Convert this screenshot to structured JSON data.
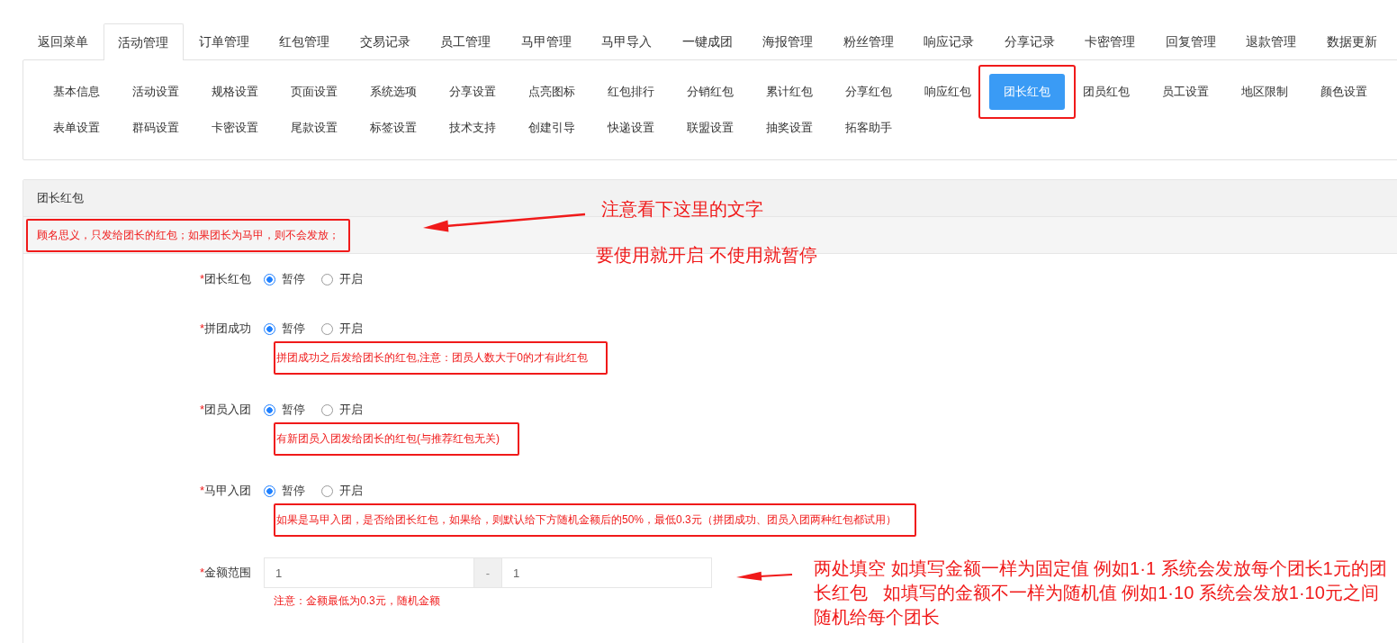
{
  "top_tabs": [
    {
      "label": "返回菜单",
      "selected": false
    },
    {
      "label": "活动管理",
      "selected": true
    },
    {
      "label": "订单管理",
      "selected": false
    },
    {
      "label": "红包管理",
      "selected": false
    },
    {
      "label": "交易记录",
      "selected": false
    },
    {
      "label": "员工管理",
      "selected": false
    },
    {
      "label": "马甲管理",
      "selected": false
    },
    {
      "label": "马甲导入",
      "selected": false
    },
    {
      "label": "一键成团",
      "selected": false
    },
    {
      "label": "海报管理",
      "selected": false
    },
    {
      "label": "粉丝管理",
      "selected": false
    },
    {
      "label": "响应记录",
      "selected": false
    },
    {
      "label": "分享记录",
      "selected": false
    },
    {
      "label": "卡密管理",
      "selected": false
    },
    {
      "label": "回复管理",
      "selected": false
    },
    {
      "label": "退款管理",
      "selected": false
    },
    {
      "label": "数据更新",
      "selected": false
    }
  ],
  "sub_tabs": [
    {
      "label": "基本信息",
      "selected": false,
      "annotated": false
    },
    {
      "label": "活动设置",
      "selected": false,
      "annotated": false
    },
    {
      "label": "规格设置",
      "selected": false,
      "annotated": false
    },
    {
      "label": "页面设置",
      "selected": false,
      "annotated": false
    },
    {
      "label": "系统选项",
      "selected": false,
      "annotated": false
    },
    {
      "label": "分享设置",
      "selected": false,
      "annotated": false
    },
    {
      "label": "点亮图标",
      "selected": false,
      "annotated": false
    },
    {
      "label": "红包排行",
      "selected": false,
      "annotated": false
    },
    {
      "label": "分销红包",
      "selected": false,
      "annotated": false
    },
    {
      "label": "累计红包",
      "selected": false,
      "annotated": false
    },
    {
      "label": "分享红包",
      "selected": false,
      "annotated": false
    },
    {
      "label": "响应红包",
      "selected": false,
      "annotated": false
    },
    {
      "label": "团长红包",
      "selected": true,
      "annotated": true
    },
    {
      "label": "团员红包",
      "selected": false,
      "annotated": false
    },
    {
      "label": "员工设置",
      "selected": false,
      "annotated": false
    },
    {
      "label": "地区限制",
      "selected": false,
      "annotated": false
    },
    {
      "label": "颜色设置",
      "selected": false,
      "annotated": false
    },
    {
      "label": "表单设置",
      "selected": false,
      "annotated": false
    },
    {
      "label": "群码设置",
      "selected": false,
      "annotated": false
    },
    {
      "label": "卡密设置",
      "selected": false,
      "annotated": false
    },
    {
      "label": "尾款设置",
      "selected": false,
      "annotated": false
    },
    {
      "label": "标签设置",
      "selected": false,
      "annotated": false
    },
    {
      "label": "技术支持",
      "selected": false,
      "annotated": false
    },
    {
      "label": "创建引导",
      "selected": false,
      "annotated": false
    },
    {
      "label": "快递设置",
      "selected": false,
      "annotated": false
    },
    {
      "label": "联盟设置",
      "selected": false,
      "annotated": false
    },
    {
      "label": "抽奖设置",
      "selected": false,
      "annotated": false
    },
    {
      "label": "拓客助手",
      "selected": false,
      "annotated": false
    }
  ],
  "panel": {
    "title": "团长红包",
    "notice": "顾名思义，只发给团长的红包；如果团长为马甲，则不会发放；",
    "notice_annotated": true
  },
  "form": [
    {
      "kind": "radio",
      "required_mark": "*",
      "label": "团长红包",
      "options": [
        {
          "label": "暂停",
          "selected": true
        },
        {
          "label": "开启",
          "selected": false
        }
      ]
    },
    {
      "kind": "radio",
      "required_mark": "*",
      "label": "拼团成功",
      "options": [
        {
          "label": "暂停",
          "selected": true
        },
        {
          "label": "开启",
          "selected": false
        }
      ],
      "hint": "拼团成功之后发给团长的红包,注意：团员人数大于0的才有此红包",
      "hint_annotated": true
    },
    {
      "kind": "radio",
      "required_mark": "*",
      "label": "团员入团",
      "options": [
        {
          "label": "暂停",
          "selected": true
        },
        {
          "label": "开启",
          "selected": false
        }
      ],
      "hint": "有新团员入团发给团长的红包(与推荐红包无关)",
      "hint_annotated": true
    },
    {
      "kind": "radio",
      "required_mark": "*",
      "label": "马甲入团",
      "options": [
        {
          "label": "暂停",
          "selected": true
        },
        {
          "label": "开启",
          "selected": false
        }
      ],
      "hint": "如果是马甲入团，是否给团长红包，如果给，则默认给下方随机金额后的50%，最低0.3元（拼团成功、团员入团两种红包都试用）",
      "hint_annotated": true
    },
    {
      "kind": "range",
      "required_mark": "*",
      "label": "金额范围",
      "min_value": "1",
      "separator": "-",
      "max_value": "1",
      "hint": "注意：金额最低为0.3元，随机金额",
      "hint_annotated": false
    }
  ],
  "annotation_notes": [
    {
      "text": "注意看下这里的文字"
    },
    {
      "text": "要使用就开启 不使用就暂停"
    },
    {
      "text": "两处填空 如填写金额一样为固定值 例如1·1 系统会发放每个团长1元的团长红包   如填写的金额不一样为随机值 例如1·10 系统会发放1·10元之间随机给每个团长"
    }
  ]
}
